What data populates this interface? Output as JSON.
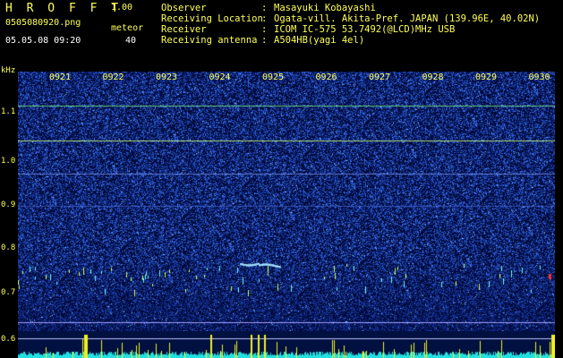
{
  "header": {
    "app_title": "H R O F F T",
    "app_version": "1.00",
    "filename": "0505080920.png",
    "datetime": "05.05.08 09:20",
    "meteor_label": "meteor",
    "meteor_count": "40"
  },
  "info": {
    "observer_key": "Observer",
    "observer_val": "Masayuki Kobayashi",
    "location_key": "Receiving Location",
    "location_val": "Ogata-vill. Akita-Pref. JAPAN (139.96E, 40.02N)",
    "receiver_key": "Receiver",
    "receiver_val": "ICOM IC-575 53.7492(@LCD)MHz USB",
    "antenna_key": "Receiving antenna",
    "antenna_val": "A504HB(yagi 4el)",
    "sep": ":"
  },
  "axis": {
    "unit": "kHz",
    "y_labels": [
      "1.1",
      "1.0",
      "0.9",
      "0.8",
      "0.7",
      "0.6"
    ],
    "time_labels": [
      "0921",
      "0922",
      "0923",
      "0924",
      "0925",
      "0926",
      "0927",
      "0928",
      "0929",
      "0930"
    ]
  },
  "colors": {
    "accent_yellow": "#ffff55",
    "background": "#000000",
    "spectrum_base": "#000a3a",
    "noise_blue": "#2a50ff",
    "carrier_line": "#c8ff80",
    "meteor_red": "#ff3030",
    "strip_cyan": "#22e0e0",
    "strip_yellow": "#f0f020"
  }
}
